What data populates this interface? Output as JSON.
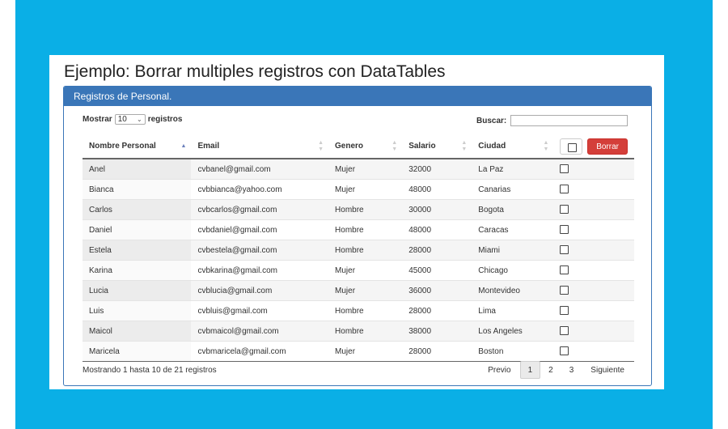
{
  "page": {
    "title": "Ejemplo: Borrar multiples registros con DataTables"
  },
  "panel": {
    "heading": "Registros de Personal."
  },
  "length_control": {
    "prefix": "Mostrar",
    "selected": "10",
    "suffix": "registros"
  },
  "search": {
    "label": "Buscar:",
    "value": ""
  },
  "table": {
    "columns": [
      {
        "label": "Nombre Personal",
        "sort": "asc"
      },
      {
        "label": "Email",
        "sort": "both"
      },
      {
        "label": "Genero",
        "sort": "both"
      },
      {
        "label": "Salario",
        "sort": "both"
      },
      {
        "label": "Ciudad",
        "sort": "both"
      }
    ],
    "delete_button_label": "Borrar",
    "rows": [
      [
        "Anel",
        "cvbanel@gmail.com",
        "Mujer",
        "32000",
        "La Paz"
      ],
      [
        "Bianca",
        "cvbbianca@yahoo.com",
        "Mujer",
        "48000",
        "Canarias"
      ],
      [
        "Carlos",
        "cvbcarlos@gmail.com",
        "Hombre",
        "30000",
        "Bogota"
      ],
      [
        "Daniel",
        "cvbdaniel@gmail.com",
        "Hombre",
        "48000",
        "Caracas"
      ],
      [
        "Estela",
        "cvbestela@gmail.com",
        "Hombre",
        "28000",
        "Miami"
      ],
      [
        "Karina",
        "cvbkarina@gmail.com",
        "Mujer",
        "45000",
        "Chicago"
      ],
      [
        "Lucia",
        "cvblucia@gmail.com",
        "Mujer",
        "36000",
        "Montevideo"
      ],
      [
        "Luis",
        "cvbluis@gmail.com",
        "Hombre",
        "28000",
        "Lima"
      ],
      [
        "Maicol",
        "cvbmaicol@gmail.com",
        "Hombre",
        "38000",
        "Los Angeles"
      ],
      [
        "Maricela",
        "cvbmaricela@gmail.com",
        "Mujer",
        "28000",
        "Boston"
      ]
    ]
  },
  "info": {
    "text": "Mostrando 1 hasta 10 de 21 registros"
  },
  "pagination": {
    "previous": "Previo",
    "pages": [
      "1",
      "2",
      "3"
    ],
    "current": "1",
    "next": "Siguiente"
  },
  "colors": {
    "background": "#0aafe6",
    "panel_heading": "#3a76b8",
    "delete_button": "#d43f3a"
  }
}
